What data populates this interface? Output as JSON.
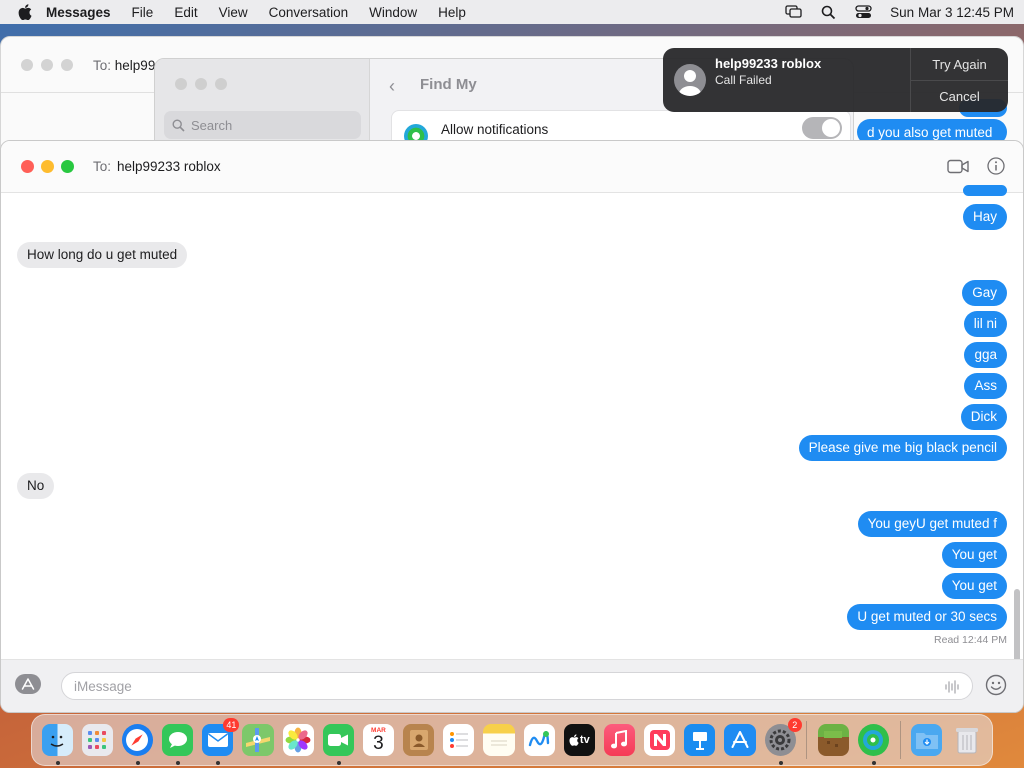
{
  "menubar": {
    "app_name": "Messages",
    "items": [
      "File",
      "Edit",
      "View",
      "Conversation",
      "Window",
      "Help"
    ],
    "clock": "Sun Mar 3  12:45 PM"
  },
  "bg_window": {
    "to_label": "To:",
    "recipient_fragment": "help99",
    "bubble_fragment": "d you also get muted"
  },
  "settings_window": {
    "search_placeholder": "Search",
    "title": "Find My",
    "row_label": "Allow notifications"
  },
  "notification": {
    "title": "help99233 roblox",
    "subtitle": "Call Failed",
    "action_primary": "Try Again",
    "action_secondary": "Cancel"
  },
  "chat": {
    "to_label": "To:",
    "recipient": "help99233 roblox",
    "messages": [
      {
        "dir": "out",
        "text": "Hay"
      },
      {
        "dir": "in",
        "text": "How long do u get muted"
      },
      {
        "dir": "out",
        "text": "Gay"
      },
      {
        "dir": "out",
        "text": "lil ni"
      },
      {
        "dir": "out",
        "text": "gga"
      },
      {
        "dir": "out",
        "text": "Ass"
      },
      {
        "dir": "out",
        "text": "Dick"
      },
      {
        "dir": "out",
        "text": "Please give me big black pencil"
      },
      {
        "dir": "in",
        "text": "No"
      },
      {
        "dir": "out",
        "text": "You geyU get muted f"
      },
      {
        "dir": "out",
        "text": "You get"
      },
      {
        "dir": "out",
        "text": "You get"
      },
      {
        "dir": "out",
        "text": "U get muted or 30 secs"
      }
    ],
    "read_receipt": "Read 12:44 PM",
    "composer_placeholder": "iMessage"
  },
  "dock": {
    "mail_badge": "41",
    "calendar_month": "MAR",
    "calendar_day": "3",
    "settings_badge": "2",
    "tv_label": "tv"
  },
  "colors": {
    "bubble_out": "#1f8cf2",
    "bubble_in": "#e9e9eb",
    "close": "#ff5f57",
    "minimize": "#febc2e",
    "zoom": "#28c840"
  }
}
